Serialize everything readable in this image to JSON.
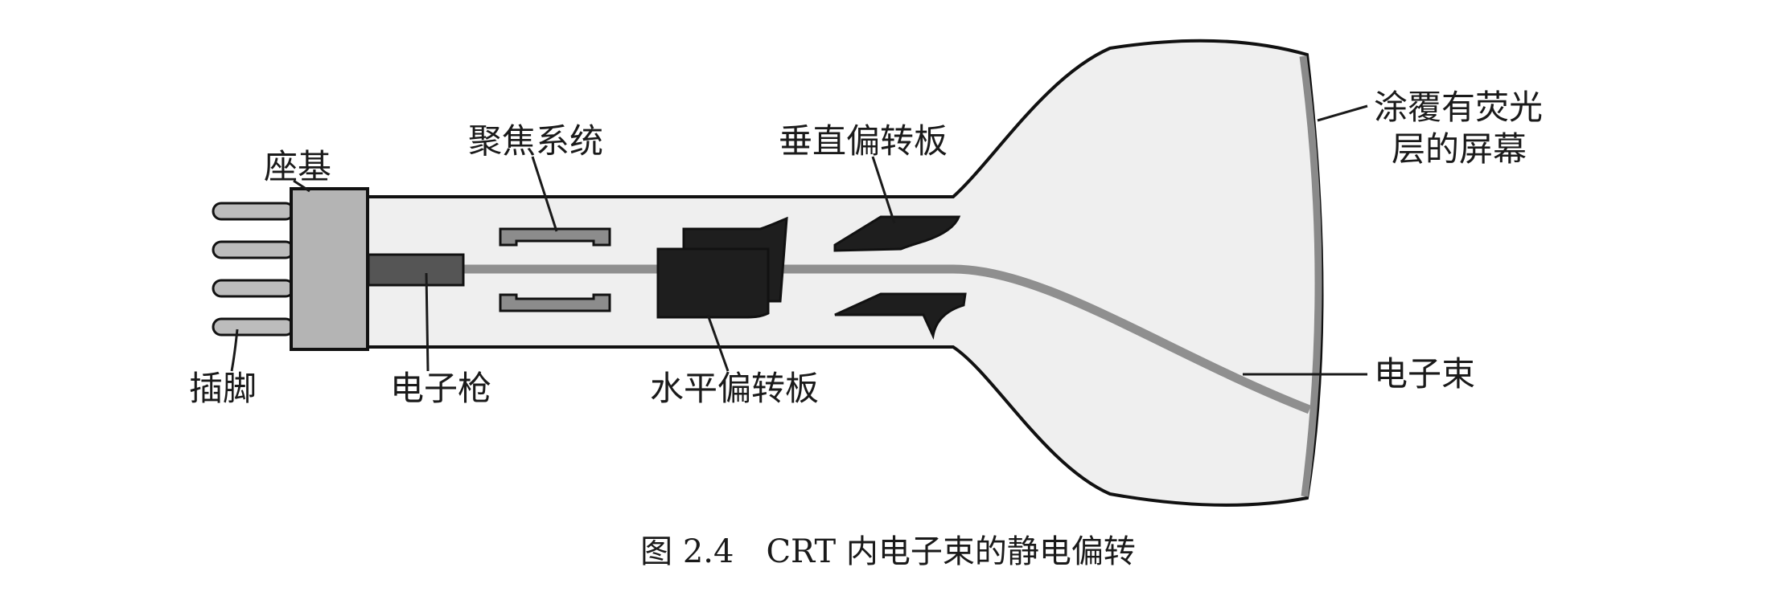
{
  "labels": {
    "base": "座基",
    "pins": "插脚",
    "focusing_system": "聚焦系统",
    "vertical_plates": "垂直偏转板",
    "electron_gun": "电子枪",
    "horizontal_plates": "水平偏转板",
    "screen_line1": "涂覆有荧光",
    "screen_line2": "层的屏幕",
    "electron_beam": "电子束"
  },
  "caption": "图 2.4　CRT 内电子束的静电偏转",
  "colors": {
    "tube_fill": "#efefef",
    "tube_outline": "#111111",
    "base_fill": "#b4b4b4",
    "gun_fill": "#555555",
    "plate_fill": "#1e1e1e",
    "focus_fill": "#8c8c8c",
    "beam": "#8f8f8f",
    "phosphor": "#8a8a8a"
  }
}
